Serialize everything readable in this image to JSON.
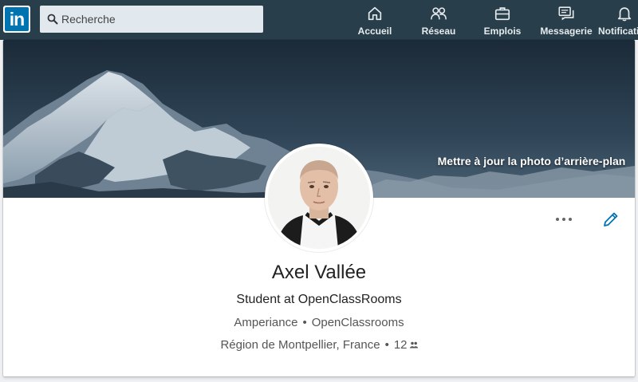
{
  "nav": {
    "logo": "in",
    "search_placeholder": "Recherche",
    "items": [
      {
        "label": "Accueil",
        "icon": "home-icon"
      },
      {
        "label": "Réseau",
        "icon": "network-icon"
      },
      {
        "label": "Emplois",
        "icon": "briefcase-icon"
      },
      {
        "label": "Messagerie",
        "icon": "messaging-icon"
      },
      {
        "label": "Notificati",
        "icon": "bell-icon"
      }
    ]
  },
  "profile": {
    "banner_cta": "Mettre à jour la photo d’arrière-plan",
    "name": "Axel Vallée",
    "headline": "Student at OpenClassRooms",
    "companies": [
      "Amperiance",
      "OpenClassrooms"
    ],
    "location": "Région de Montpellier, France",
    "connections": "12"
  },
  "colors": {
    "topbar": "#283e4a",
    "brand": "#0073b1",
    "edit_icon": "#0073b1"
  }
}
